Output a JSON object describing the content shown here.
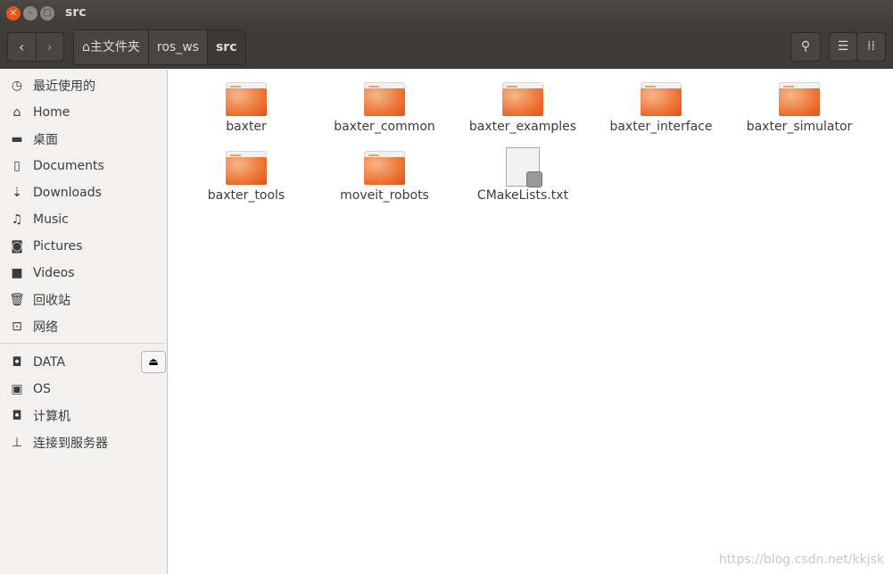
{
  "window": {
    "title": "src"
  },
  "toolbar": {
    "back_icon": "‹",
    "forward_icon": "›",
    "breadcrumbs": [
      "主文件夹",
      "ros_ws",
      "src"
    ]
  },
  "sidebar": {
    "items": [
      {
        "label": "最近使用的",
        "icon": "clock-icon",
        "glyph": "◷"
      },
      {
        "label": "Home",
        "icon": "home-icon",
        "glyph": "⌂"
      },
      {
        "label": "桌面",
        "icon": "folder-icon",
        "glyph": "▬"
      },
      {
        "label": "Documents",
        "icon": "document-icon",
        "glyph": "▯"
      },
      {
        "label": "Downloads",
        "icon": "download-icon",
        "glyph": "⇣"
      },
      {
        "label": "Music",
        "icon": "music-icon",
        "glyph": "♫"
      },
      {
        "label": "Pictures",
        "icon": "camera-icon",
        "glyph": "◙"
      },
      {
        "label": "Videos",
        "icon": "video-icon",
        "glyph": "■"
      },
      {
        "label": "回收站",
        "icon": "trash-icon",
        "glyph": "🗑"
      },
      {
        "label": "网络",
        "icon": "network-icon",
        "glyph": "⊡"
      }
    ],
    "devices": [
      {
        "label": "DATA",
        "icon": "drive-icon",
        "glyph": "◘"
      },
      {
        "label": "OS",
        "icon": "chip-icon",
        "glyph": "▣"
      },
      {
        "label": "计算机",
        "icon": "drive-icon",
        "glyph": "◘"
      },
      {
        "label": "连接到服务器",
        "icon": "server-icon",
        "glyph": "⊥"
      }
    ]
  },
  "files": [
    {
      "name": "baxter",
      "type": "folder"
    },
    {
      "name": "baxter_common",
      "type": "folder"
    },
    {
      "name": "baxter_examples",
      "type": "folder"
    },
    {
      "name": "baxter_interface",
      "type": "folder"
    },
    {
      "name": "baxter_simulator",
      "type": "folder"
    },
    {
      "name": "baxter_tools",
      "type": "folder"
    },
    {
      "name": "moveit_robots",
      "type": "folder"
    },
    {
      "name": "CMakeLists.txt",
      "type": "text-file-link"
    }
  ],
  "watermark": "https://blog.csdn.net/kkjsk"
}
